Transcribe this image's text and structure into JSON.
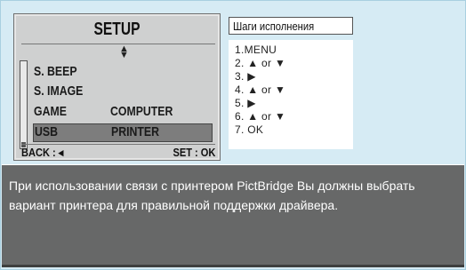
{
  "lcd": {
    "title": "SETUP",
    "updown_icon": "▲▼",
    "items": [
      {
        "label": "S. BEEP",
        "value": ""
      },
      {
        "label": "S. IMAGE",
        "value": ""
      },
      {
        "label": "GAME",
        "value": "COMPUTER"
      },
      {
        "label": "USB",
        "value": "PRINTER"
      }
    ],
    "selected_index": 3,
    "footer": {
      "back": "BACK : ◂",
      "set": "SET : OK"
    }
  },
  "steps": {
    "header": "Шаги исполнения",
    "items": [
      "1.MENU",
      "2. ▲ or ▼",
      "3. ▶",
      "4. ▲ or ▼",
      "5. ▶",
      "6. ▲ or ▼",
      "7. OK"
    ]
  },
  "description": "При использовании связи с принтером PictBridge Вы должны выбрать вариант принтера для правильной поддержки драйвера.",
  "colors": {
    "frame_bg": "#d6ebf4",
    "lcd_bg": "#cfd0d0",
    "selected_row": "#7d7d7d",
    "desc_bg": "#676868"
  }
}
